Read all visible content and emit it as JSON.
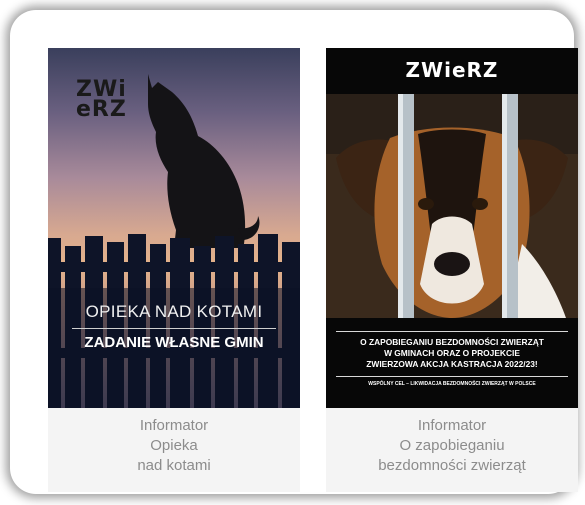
{
  "cards": [
    {
      "cover": {
        "logo_line1": "ZWi",
        "logo_line2": "eRZ",
        "title": "OPIEKA NAD KOTAMI",
        "subtitle": "ZADANIE WŁASNE GMIN"
      },
      "caption": [
        "Informator",
        "Opieka",
        "nad kotami"
      ]
    },
    {
      "cover": {
        "logo": "ZWieRZ",
        "headline": [
          "O ZAPOBIEGANIU BEZDOMNOŚCI ZWIERZĄT",
          "W GMINACH ORAZ O PROJEKCIE",
          "ZWIERZOWA AKCJA KASTRACJA 2022/23!"
        ],
        "footer": "WSPÓLNY CEL – LIKWIDACJA BEZDOMNOŚCI ZWIERZĄT W POLSCE"
      },
      "caption": [
        "Informator",
        "O zapobieganiu",
        "bezdomności zwierząt"
      ]
    }
  ],
  "colors": {
    "caption_text": "#8c8c8c",
    "card_background": "#f4f4f4",
    "frame_shadow": "#5e5e5e"
  }
}
